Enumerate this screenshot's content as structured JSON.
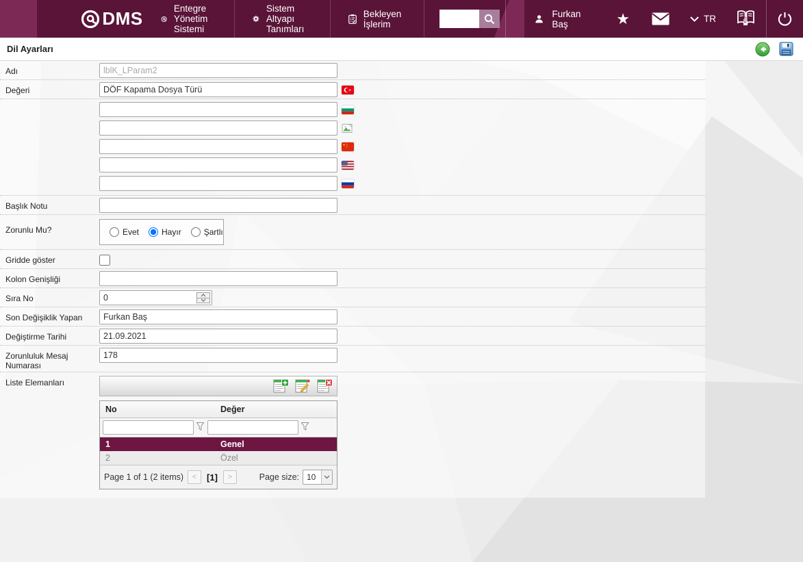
{
  "navbar": {
    "logo_text": "DMS",
    "menu": [
      {
        "label": "Entegre Yönetim Sistemi",
        "icon": "qdms-ring-icon"
      },
      {
        "label": "Sistem Altyapı Tanımları",
        "icon": "gear-icon"
      },
      {
        "label": "Bekleyen İşlerim",
        "icon": "clipboard-check-icon"
      }
    ],
    "search": {
      "value": "",
      "icon": "search-icon"
    },
    "user": {
      "name": "Furkan Baş",
      "icon": "person-icon"
    },
    "favorites_icon": "★",
    "mail_icon": "envelope-icon",
    "language": {
      "label": "TR",
      "icon": "chevron-down-icon"
    },
    "help_icon": "book-hand-icon",
    "power_icon": "power-icon",
    "colors": {
      "bar": "#5a1438",
      "band": "#7c2a55",
      "search_button": "#a77e9b"
    }
  },
  "titlebar": {
    "title": "Dil Ayarları",
    "back_icon": "back-circle-icon",
    "save_icon": "save-floppy-icon"
  },
  "form": {
    "adi": {
      "label": "Adı",
      "value": "lblK_LParam2",
      "disabled": true
    },
    "degeri": {
      "label": "Değeri",
      "value": "DÖF Kapama Dosya Türü",
      "flag": "turkey"
    },
    "translations": [
      {
        "value": "",
        "flag": "bulgaria"
      },
      {
        "value": "",
        "flag": "missing-image"
      },
      {
        "value": "",
        "flag": "china"
      },
      {
        "value": "",
        "flag": "usa"
      },
      {
        "value": "",
        "flag": "russia"
      }
    ],
    "baslik_notu": {
      "label": "Başlık Notu",
      "value": ""
    },
    "zorunlu": {
      "label": "Zorunlu Mu?",
      "options": [
        "Evet",
        "Hayır",
        "Şartlı"
      ],
      "selected": "Hayır"
    },
    "gridde": {
      "label": "Gridde göster",
      "checked": false
    },
    "kolon": {
      "label": "Kolon Genişliği",
      "value": ""
    },
    "sira": {
      "label": "Sıra No",
      "value": "0"
    },
    "son_degisiklik": {
      "label": "Son Değişiklik Yapan",
      "value": "Furkan Baş"
    },
    "tarih": {
      "label": "Değiştirme Tarihi",
      "value": "21.09.2021"
    },
    "mesaj": {
      "label": "Zorunluluk Mesaj Numarası",
      "value": "178"
    },
    "liste": {
      "label": "Liste Elemanları",
      "toolbar_icons": [
        "list-add-icon",
        "list-edit-icon",
        "list-delete-icon"
      ]
    }
  },
  "grid": {
    "columns": {
      "no": "No",
      "deger": "Değer"
    },
    "filters": {
      "no": "",
      "deger": "",
      "icon": "funnel-icon"
    },
    "rows": [
      {
        "no": "1",
        "deger": "Genel",
        "selected": true
      },
      {
        "no": "2",
        "deger": "Özel",
        "selected": false
      }
    ],
    "pager": {
      "summary": "Page 1 of 1 (2 items)",
      "prev": "<",
      "current": "[1]",
      "next": ">",
      "page_size_label": "Page size:",
      "page_size": "10"
    },
    "selected_color": "#6e1642"
  }
}
